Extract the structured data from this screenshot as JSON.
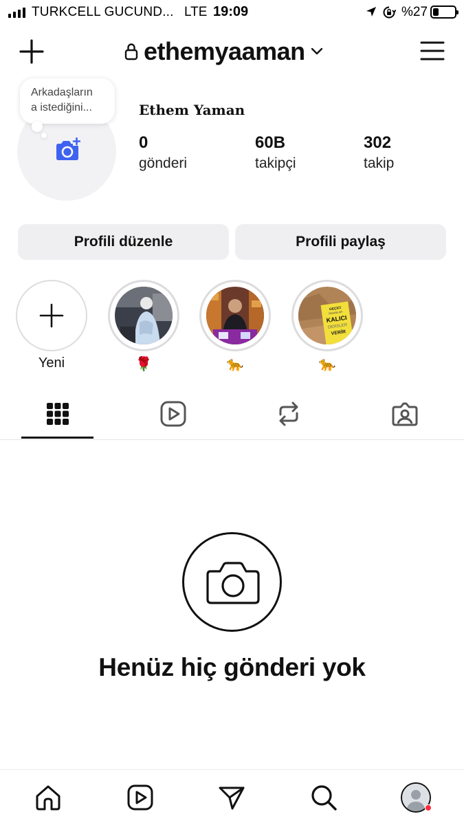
{
  "status_bar": {
    "carrier": "TURKCELL GUCUND...",
    "network": "LTE",
    "time": "19:09",
    "battery_text": "%27",
    "battery_level": 0.27
  },
  "header": {
    "username": "ethemyaaman",
    "icons": [
      "plus-icon",
      "lock-icon",
      "chevron-down-icon",
      "menu-icon"
    ]
  },
  "profile": {
    "note_line1": "Arkadaşların",
    "note_line2": "a istediğini...",
    "name": "Ethem Yaman",
    "stats": [
      {
        "count": "0",
        "label": "gönderi"
      },
      {
        "count": "60B",
        "label": "takipçi"
      },
      {
        "count": "302",
        "label": "takip"
      }
    ]
  },
  "actions": {
    "edit_profile": "Profili düzenle",
    "share_profile": "Profili paylaş"
  },
  "highlights": [
    {
      "label": "Yeni",
      "kind": "new"
    },
    {
      "label": "🌹",
      "kind": "story"
    },
    {
      "label": "🐆",
      "kind": "story"
    },
    {
      "label": "🐆",
      "kind": "story"
    }
  ],
  "highlight_sign": {
    "line1": "GEÇİCİ",
    "line2": "İNSANLAR",
    "line3": "KALICI",
    "line4": "DERSLER",
    "line5": "VERİR"
  },
  "tabs": [
    "grid-icon",
    "reels-icon",
    "reposts-icon",
    "tagged-icon"
  ],
  "empty_state": {
    "title": "Henüz hiç gönderi yok"
  },
  "colors": {
    "accent": "#3f63f0",
    "notification": "#ff2d3c",
    "button_bg": "#efeff1"
  },
  "bottom_nav": [
    "home-icon",
    "reels-icon",
    "messages-icon",
    "search-icon",
    "profile-avatar"
  ]
}
